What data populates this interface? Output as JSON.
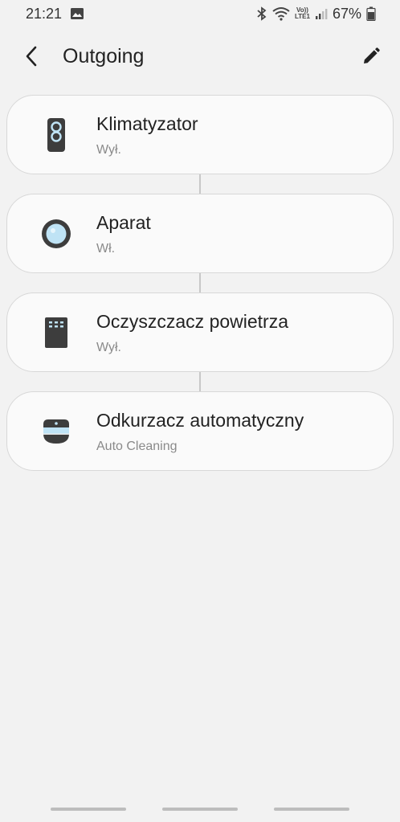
{
  "status_bar": {
    "time": "21:21",
    "battery_percent": "67%",
    "volte_label_top": "Vo))",
    "volte_label_bottom": "LTE1",
    "icons": [
      "gallery-icon",
      "bluetooth-icon",
      "wifi-icon",
      "volte-icon",
      "signal-icon",
      "battery-icon"
    ]
  },
  "header": {
    "title": "Outgoing",
    "back_icon": "back-arrow-icon",
    "edit_icon": "pencil-icon"
  },
  "devices": [
    {
      "name": "Klimatyzator",
      "status": "Wył.",
      "icon": "air-conditioner-icon"
    },
    {
      "name": "Aparat",
      "status": "Wł.",
      "icon": "camera-icon"
    },
    {
      "name": "Oczyszczacz powietrza",
      "status": "Wył.",
      "icon": "air-purifier-icon"
    },
    {
      "name": "Odkurzacz automatyczny",
      "status": "Auto Cleaning",
      "icon": "robot-vacuum-icon"
    }
  ],
  "colors": {
    "background": "#f2f2f2",
    "card": "#fafafa",
    "card_border": "#d8d8d8",
    "secondary_text": "#8a8a8a",
    "icon_dark": "#3d3d3d",
    "icon_light_blue": "#bfe3f5"
  }
}
